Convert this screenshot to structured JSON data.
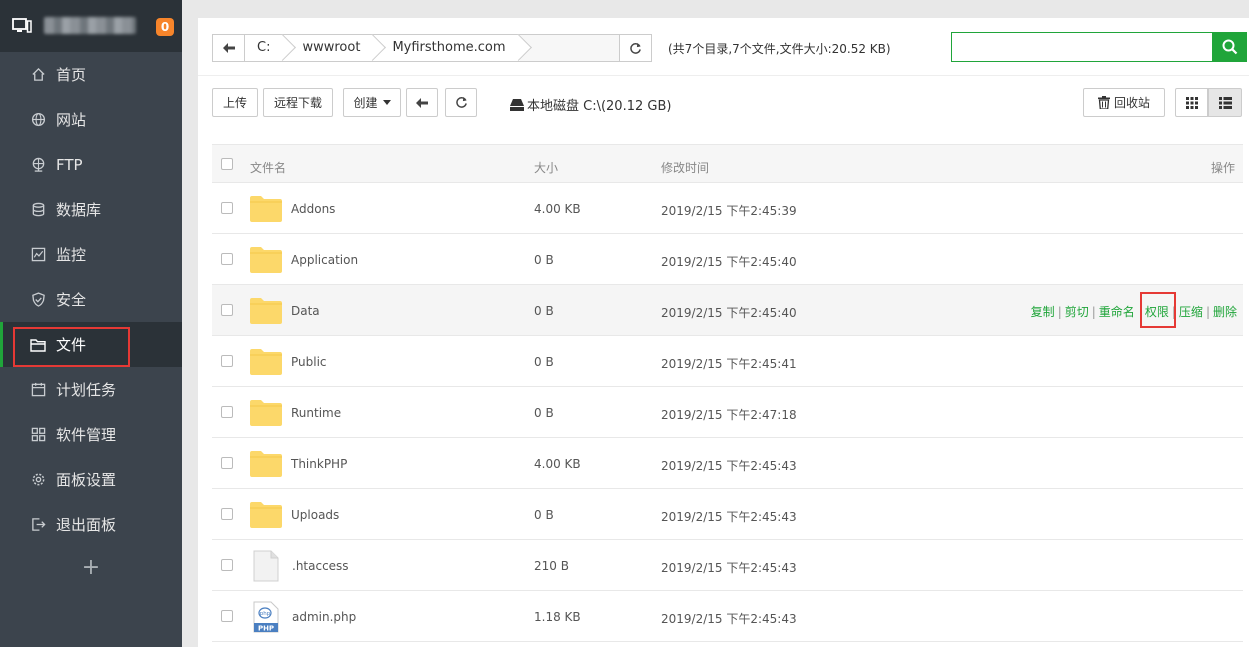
{
  "sidebar": {
    "badge": "0",
    "items": [
      {
        "label": "首页",
        "icon": "home-icon"
      },
      {
        "label": "网站",
        "icon": "globe-icon"
      },
      {
        "label": "FTP",
        "icon": "ftp-icon"
      },
      {
        "label": "数据库",
        "icon": "database-icon"
      },
      {
        "label": "监控",
        "icon": "monitor-chart-icon"
      },
      {
        "label": "安全",
        "icon": "shield-icon"
      },
      {
        "label": "文件",
        "icon": "folder-icon"
      },
      {
        "label": "计划任务",
        "icon": "calendar-icon"
      },
      {
        "label": "软件管理",
        "icon": "grid-icon"
      },
      {
        "label": "面板设置",
        "icon": "gear-icon"
      },
      {
        "label": "退出面板",
        "icon": "logout-icon"
      }
    ],
    "add_label": "+"
  },
  "path": {
    "crumbs": [
      "C:",
      "wwwroot",
      "Myfirsthome.com"
    ],
    "info": "(共7个目录,7个文件,文件大小:20.52 KB)"
  },
  "toolbar": {
    "upload": "上传",
    "remote_download": "远程下载",
    "create": "创建",
    "disk": "本地磁盘 C:\\(20.12 GB)",
    "recycle": "回收站"
  },
  "table": {
    "headers": {
      "name": "文件名",
      "size": "大小",
      "time": "修改时间",
      "op": "操作"
    },
    "rows": [
      {
        "name": "Addons",
        "size": "4.00 KB",
        "time": "2019/2/15 下午2:45:39",
        "type": "folder"
      },
      {
        "name": "Application",
        "size": "0 B",
        "time": "2019/2/15 下午2:45:40",
        "type": "folder"
      },
      {
        "name": "Data",
        "size": "0 B",
        "time": "2019/2/15 下午2:45:40",
        "type": "folder"
      },
      {
        "name": "Public",
        "size": "0 B",
        "time": "2019/2/15 下午2:45:41",
        "type": "folder"
      },
      {
        "name": "Runtime",
        "size": "0 B",
        "time": "2019/2/15 下午2:47:18",
        "type": "folder"
      },
      {
        "name": "ThinkPHP",
        "size": "4.00 KB",
        "time": "2019/2/15 下午2:45:43",
        "type": "folder"
      },
      {
        "name": "Uploads",
        "size": "0 B",
        "time": "2019/2/15 下午2:45:43",
        "type": "folder"
      },
      {
        "name": ".htaccess",
        "size": "210 B",
        "time": "2019/2/15 下午2:45:43",
        "type": "file"
      },
      {
        "name": "admin.php",
        "size": "1.18 KB",
        "time": "2019/2/15 下午2:45:43",
        "type": "php"
      }
    ],
    "ops": [
      "复制",
      "剪切",
      "重命名",
      "权限",
      "压缩",
      "删除"
    ],
    "php_label": "PHP",
    "php_small": "php"
  },
  "colors": {
    "accent": "#20a53a",
    "sidebar": "#3c444d",
    "highlight": "#e53935",
    "folder": "#fcd86a"
  }
}
